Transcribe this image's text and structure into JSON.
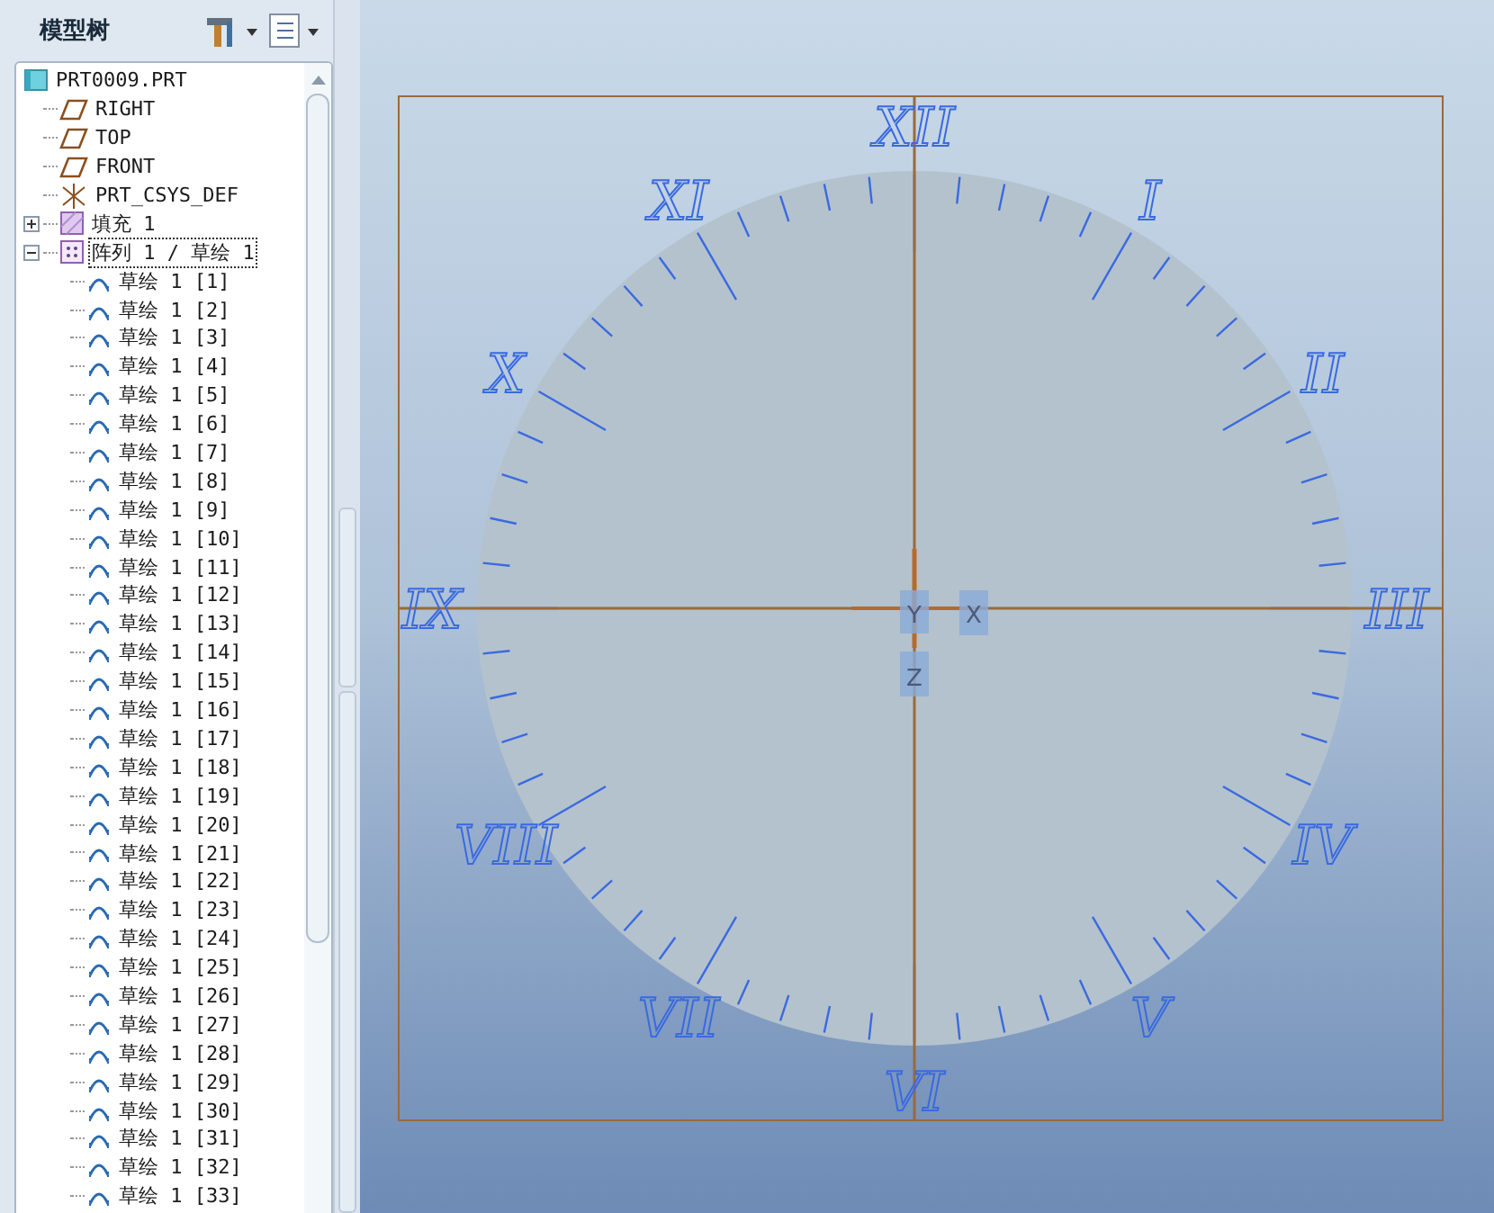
{
  "panel": {
    "title": "模型树"
  },
  "tree": {
    "label": "PRT0009.PRT",
    "kind": "part",
    "children": [
      {
        "label": "RIGHT",
        "kind": "plane"
      },
      {
        "label": "TOP",
        "kind": "plane"
      },
      {
        "label": "FRONT",
        "kind": "plane"
      },
      {
        "label": "PRT_CSYS_DEF",
        "kind": "csys"
      },
      {
        "label": "填充 1",
        "kind": "fill",
        "expanded": false,
        "selected": false
      },
      {
        "label": "阵列 1 / 草绘 1",
        "kind": "pattern",
        "expanded": true,
        "selected": true,
        "children": [
          {
            "label": "草绘 1 [1]",
            "kind": "sketch"
          },
          {
            "label": "草绘 1 [2]",
            "kind": "sketch"
          },
          {
            "label": "草绘 1 [3]",
            "kind": "sketch"
          },
          {
            "label": "草绘 1 [4]",
            "kind": "sketch"
          },
          {
            "label": "草绘 1 [5]",
            "kind": "sketch"
          },
          {
            "label": "草绘 1 [6]",
            "kind": "sketch"
          },
          {
            "label": "草绘 1 [7]",
            "kind": "sketch"
          },
          {
            "label": "草绘 1 [8]",
            "kind": "sketch"
          },
          {
            "label": "草绘 1 [9]",
            "kind": "sketch"
          },
          {
            "label": "草绘 1 [10]",
            "kind": "sketch"
          },
          {
            "label": "草绘 1 [11]",
            "kind": "sketch"
          },
          {
            "label": "草绘 1 [12]",
            "kind": "sketch"
          },
          {
            "label": "草绘 1 [13]",
            "kind": "sketch"
          },
          {
            "label": "草绘 1 [14]",
            "kind": "sketch"
          },
          {
            "label": "草绘 1 [15]",
            "kind": "sketch"
          },
          {
            "label": "草绘 1 [16]",
            "kind": "sketch"
          },
          {
            "label": "草绘 1 [17]",
            "kind": "sketch"
          },
          {
            "label": "草绘 1 [18]",
            "kind": "sketch"
          },
          {
            "label": "草绘 1 [19]",
            "kind": "sketch"
          },
          {
            "label": "草绘 1 [20]",
            "kind": "sketch"
          },
          {
            "label": "草绘 1 [21]",
            "kind": "sketch"
          },
          {
            "label": "草绘 1 [22]",
            "kind": "sketch"
          },
          {
            "label": "草绘 1 [23]",
            "kind": "sketch"
          },
          {
            "label": "草绘 1 [24]",
            "kind": "sketch"
          },
          {
            "label": "草绘 1 [25]",
            "kind": "sketch"
          },
          {
            "label": "草绘 1 [26]",
            "kind": "sketch"
          },
          {
            "label": "草绘 1 [27]",
            "kind": "sketch"
          },
          {
            "label": "草绘 1 [28]",
            "kind": "sketch"
          },
          {
            "label": "草绘 1 [29]",
            "kind": "sketch"
          },
          {
            "label": "草绘 1 [30]",
            "kind": "sketch"
          },
          {
            "label": "草绘 1 [31]",
            "kind": "sketch"
          },
          {
            "label": "草绘 1 [32]",
            "kind": "sketch"
          },
          {
            "label": "草绘 1 [33]",
            "kind": "sketch"
          }
        ]
      }
    ]
  },
  "viewport": {
    "numerals": [
      "XII",
      "I",
      "II",
      "III",
      "IV",
      "V",
      "VI",
      "VII",
      "VIII",
      "IX",
      "X",
      "XI"
    ],
    "axis_labels": {
      "y": "Y",
      "x": "X",
      "z": "Z"
    }
  }
}
